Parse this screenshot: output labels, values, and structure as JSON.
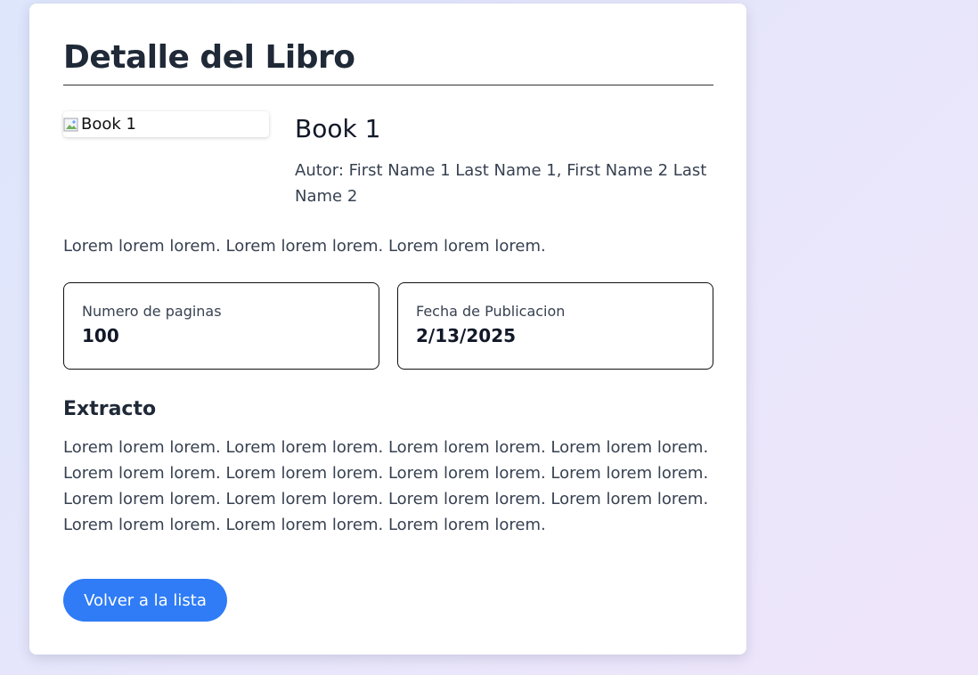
{
  "page": {
    "title": "Detalle del Libro"
  },
  "book": {
    "cover_alt": "Book 1",
    "title": "Book 1",
    "author_line": "Autor: First Name 1 Last Name 1, First Name 2 Last Name 2",
    "description": "Lorem lorem lorem. Lorem lorem lorem. Lorem lorem lorem."
  },
  "stats": {
    "pages_label": "Numero de paginas",
    "pages_value": "100",
    "date_label": "Fecha de Publicacion",
    "date_value": "2/13/2025"
  },
  "excerpt": {
    "heading": "Extracto",
    "text": "Lorem lorem lorem. Lorem lorem lorem. Lorem lorem lorem. Lorem lorem lorem. Lorem lorem lorem. Lorem lorem lorem. Lorem lorem lorem. Lorem lorem lorem. Lorem lorem lorem. Lorem lorem lorem. Lorem lorem lorem. Lorem lorem lorem. Lorem lorem lorem. Lorem lorem lorem. Lorem lorem lorem."
  },
  "actions": {
    "back_label": "Volver a la lista"
  },
  "colors": {
    "accent": "#2f7cf6",
    "card": "#ffffff",
    "text_dark": "#1f2937"
  },
  "icons": {
    "cover": "broken-image-icon"
  }
}
